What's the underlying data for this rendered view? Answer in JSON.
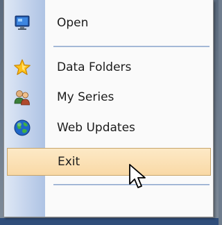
{
  "menu": {
    "items": [
      {
        "label": "Open",
        "icon": "monitor-icon"
      },
      {
        "label": "Data Folders",
        "icon": "star-icon"
      },
      {
        "label": "My Series",
        "icon": "people-icon"
      },
      {
        "label": "Web Updates",
        "icon": "globe-icon"
      },
      {
        "label": "Exit",
        "icon": "",
        "state": "hovered"
      }
    ]
  },
  "colors": {
    "gutter": "#c9d7ee",
    "hover_fill": "#f9d9a6",
    "hover_border": "#c6a46b",
    "separator": "#7f9bc4"
  },
  "cursor": {
    "icon": "arrow-cursor-icon"
  }
}
